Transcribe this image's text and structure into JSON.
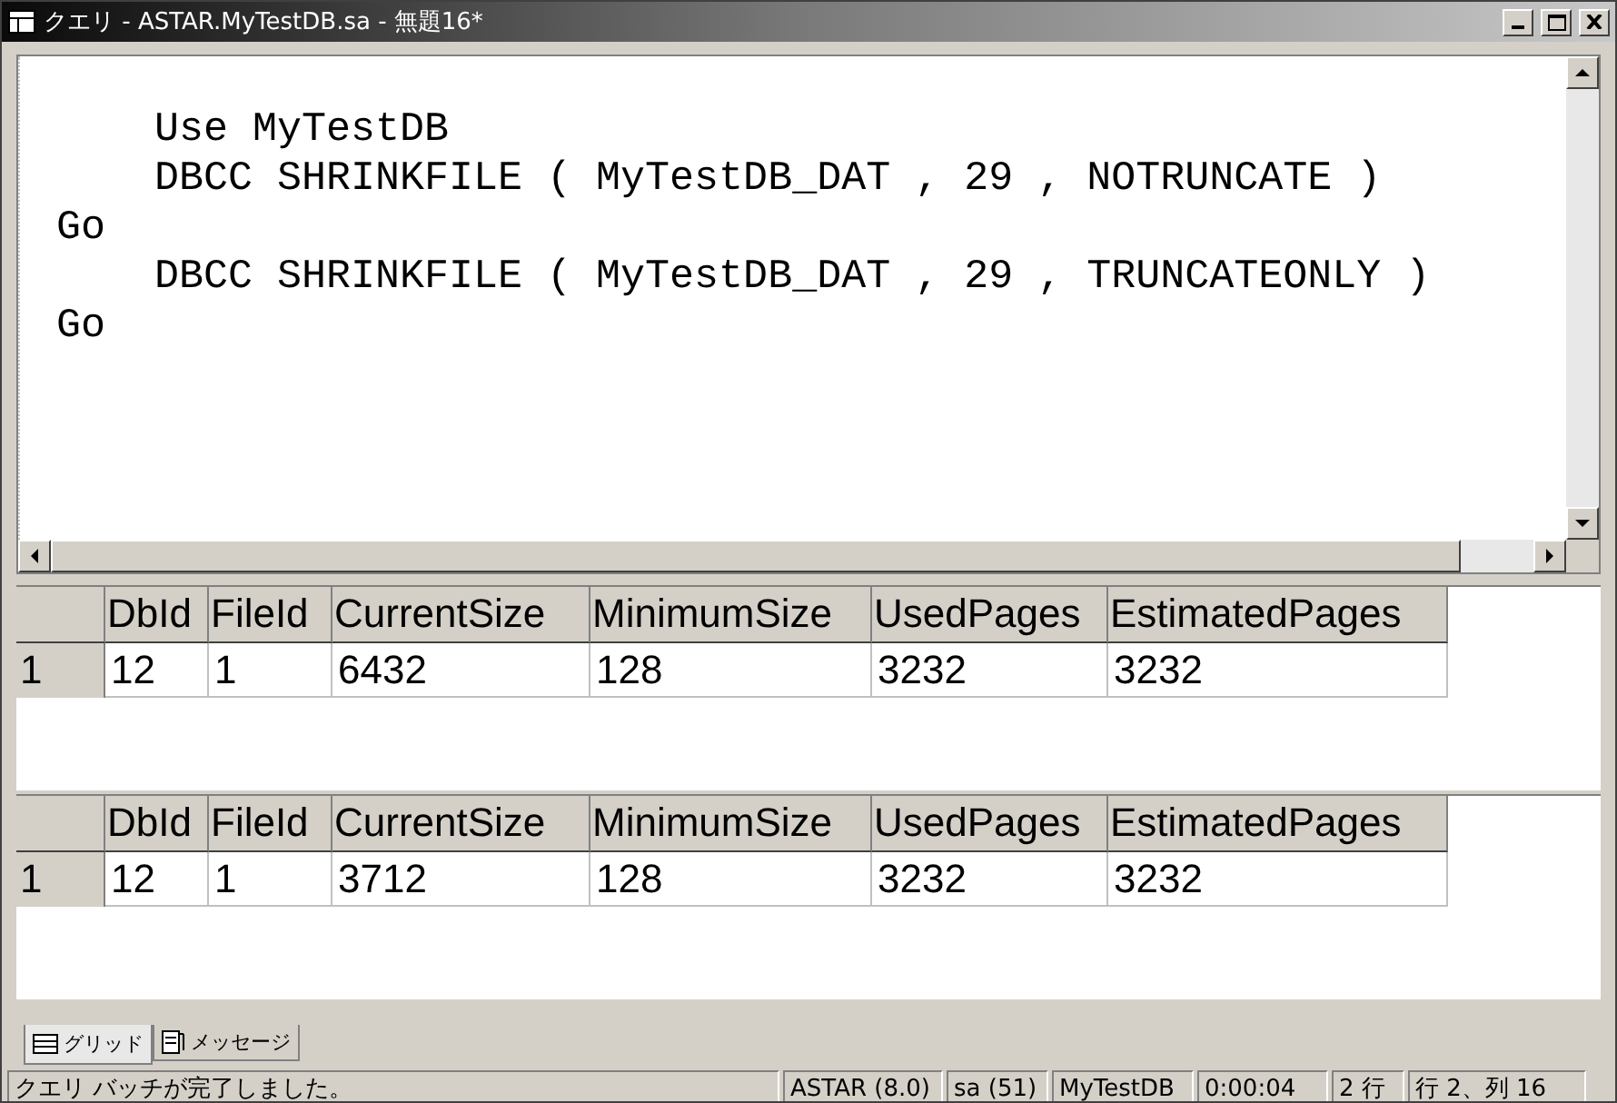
{
  "window": {
    "title": "クエリ - ASTAR.MyTestDB.sa - 無題16*"
  },
  "editor": {
    "lines": [
      "    Use MyTestDB",
      "    DBCC SHRINKFILE ( MyTestDB_DAT , 29 , NOTRUNCATE )",
      "Go",
      "    DBCC SHRINKFILE ( MyTestDB_DAT , 29 , TRUNCATEONLY )",
      "Go"
    ]
  },
  "results": [
    {
      "columns": [
        "DbId",
        "FileId",
        "CurrentSize",
        "MinimumSize",
        "UsedPages",
        "EstimatedPages"
      ],
      "rows": [
        {
          "number": "1",
          "cells": [
            "12",
            "1",
            "6432",
            "128",
            "3232",
            "3232"
          ]
        }
      ]
    },
    {
      "columns": [
        "DbId",
        "FileId",
        "CurrentSize",
        "MinimumSize",
        "UsedPages",
        "EstimatedPages"
      ],
      "rows": [
        {
          "number": "1",
          "cells": [
            "12",
            "1",
            "3712",
            "128",
            "3232",
            "3232"
          ]
        }
      ]
    }
  ],
  "tabs": [
    {
      "label": "グリッド",
      "kind": "grid",
      "selected": true
    },
    {
      "label": "メッセージ",
      "kind": "messages",
      "selected": false
    }
  ],
  "status_bar": [
    "クエリ バッチが完了しました。",
    "ASTAR (8.0)",
    "sa (51)",
    "MyTestDB",
    "0:00:04",
    "2 行",
    "行 2、列 16"
  ]
}
